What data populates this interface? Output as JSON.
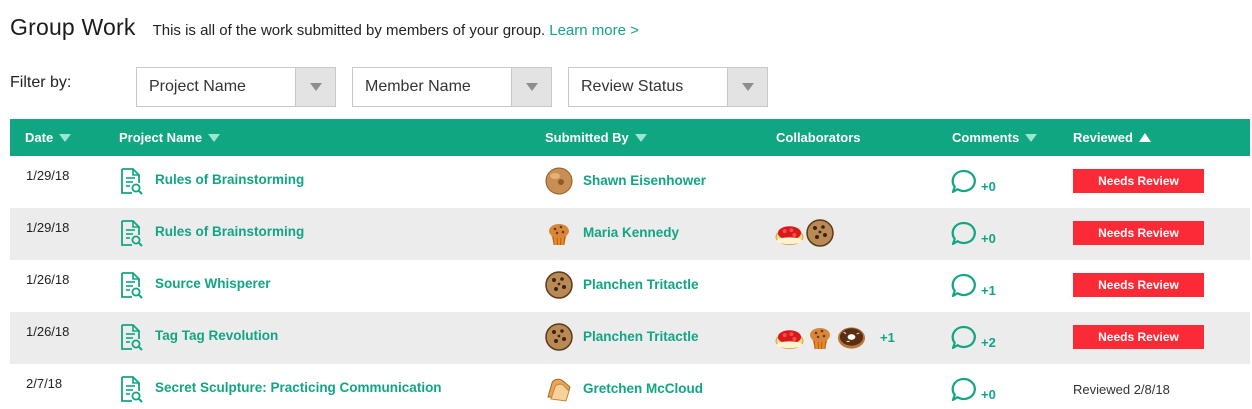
{
  "header": {
    "title": "Group Work",
    "subtitle": "This is all of the work submitted by members of your group.",
    "learn_more": "Learn more >"
  },
  "filters": {
    "label": "Filter by:",
    "selects": [
      {
        "value": "Project Name"
      },
      {
        "value": "Member Name"
      },
      {
        "value": "Review Status"
      }
    ]
  },
  "table": {
    "header_color": "#10a682",
    "columns": [
      {
        "label": "Date",
        "sort": "down"
      },
      {
        "label": "Project Name",
        "sort": "down"
      },
      {
        "label": "Submitted By",
        "sort": "down"
      },
      {
        "label": "Collaborators",
        "sort": "none"
      },
      {
        "label": "Comments",
        "sort": "down"
      },
      {
        "label": "Reviewed",
        "sort": "up"
      }
    ],
    "rows": [
      {
        "date": "1/29/18",
        "project": "Rules of Brainstorming",
        "avatar_icon": "bagel-icon",
        "member": "Shawn Eisenhower",
        "collaborators": [],
        "collaborators_more": "",
        "comments": "+0",
        "status": "Needs Review",
        "needs_review": true
      },
      {
        "date": "1/29/18",
        "project": "Rules of Brainstorming",
        "avatar_icon": "muffin-icon",
        "member": "Maria Kennedy",
        "collaborators": [
          "cherry-pie-icon",
          "cookie-icon"
        ],
        "collaborators_more": "",
        "comments": "+0",
        "status": "Needs Review",
        "needs_review": true
      },
      {
        "date": "1/26/18",
        "project": "Source Whisperer",
        "avatar_icon": "cookie-icon",
        "member": "Planchen Tritactle",
        "collaborators": [],
        "collaborators_more": "",
        "comments": "+1",
        "status": "Needs Review",
        "needs_review": true
      },
      {
        "date": "1/26/18",
        "project": "Tag Tag Revolution",
        "avatar_icon": "cookie-icon",
        "member": "Planchen Tritactle",
        "collaborators": [
          "cherry-pie-icon",
          "muffin-icon",
          "donut-icon"
        ],
        "collaborators_more": "+1",
        "comments": "+2",
        "status": "Needs Review",
        "needs_review": true
      },
      {
        "date": "2/7/18",
        "project": "Secret Sculpture: Practicing Communication",
        "avatar_icon": "toast-icon",
        "member": "Gretchen McCloud",
        "collaborators": [],
        "collaborators_more": "",
        "comments": "+0",
        "status": "Reviewed 2/8/18",
        "needs_review": false
      }
    ]
  },
  "colors": {
    "accent": "#12a584",
    "needs_review": "#fb2a37",
    "alt_row": "#ececec"
  }
}
